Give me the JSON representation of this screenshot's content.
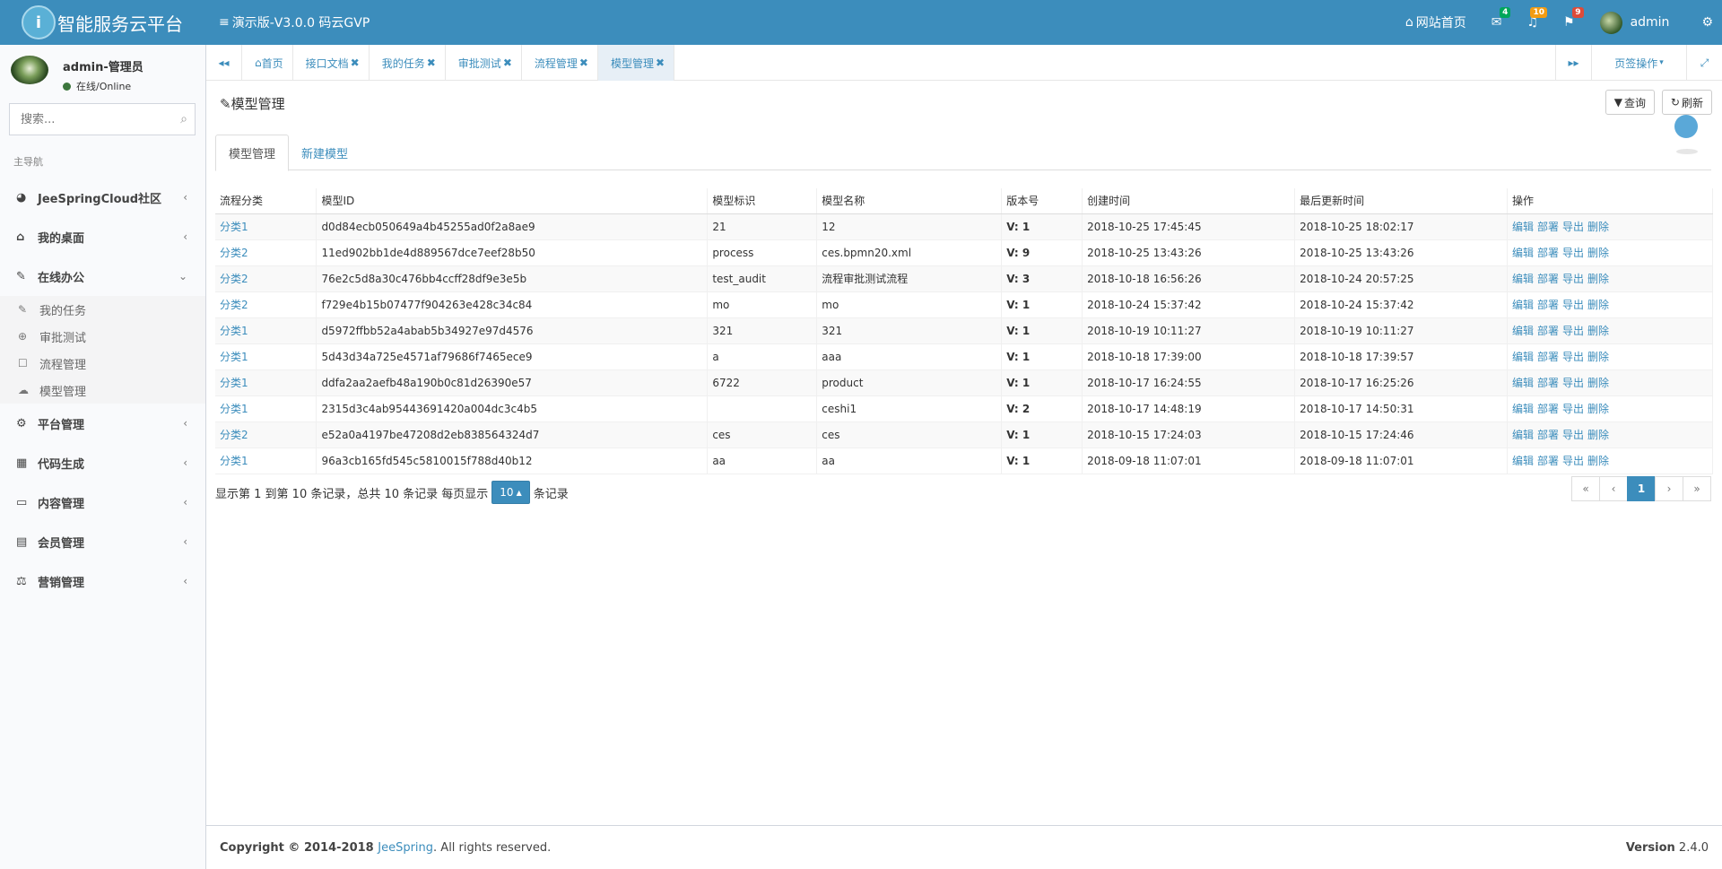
{
  "app": {
    "logo_glyph": "i",
    "title": "智能服务云平台",
    "menu_toggle_label": "演示版-V3.0.0 码云GVP"
  },
  "topnav": {
    "home_label": "网站首页",
    "mail_count": "4",
    "notif_count": "10",
    "flag_count": "9",
    "user_name": "admin"
  },
  "sidebar": {
    "user_name": "admin-管理员",
    "status": "在线/Online",
    "search_placeholder": "搜索...",
    "header": "主导航",
    "items": [
      {
        "icon": "firefox-icon",
        "glyph": "◕",
        "label": "JeeSpringCloud社区",
        "chevron": "‹"
      },
      {
        "icon": "home-icon",
        "glyph": "⌂",
        "label": "我的桌面",
        "chevron": "‹"
      },
      {
        "icon": "edit-icon",
        "glyph": "✎",
        "label": "在线办公",
        "chevron": "⌄"
      }
    ],
    "sub_items": [
      {
        "icon": "edit-icon",
        "glyph": "✎",
        "label": "我的任务"
      },
      {
        "icon": "globe-icon",
        "glyph": "⊕",
        "label": "审批测试"
      },
      {
        "icon": "square-icon",
        "glyph": "☐",
        "label": "流程管理"
      },
      {
        "icon": "cloud-icon",
        "glyph": "☁",
        "label": "模型管理"
      }
    ],
    "items2": [
      {
        "icon": "gear-icon",
        "glyph": "⚙",
        "label": "平台管理",
        "chevron": "‹"
      },
      {
        "icon": "grid-icon",
        "glyph": "▦",
        "label": "代码生成",
        "chevron": "‹"
      },
      {
        "icon": "desktop-icon",
        "glyph": "▭",
        "label": "内容管理",
        "chevron": "‹"
      },
      {
        "icon": "map-icon",
        "glyph": "▤",
        "label": "会员管理",
        "chevron": "‹"
      },
      {
        "icon": "balance-icon",
        "glyph": "⚖",
        "label": "营销管理",
        "chevron": "‹"
      }
    ]
  },
  "tabs": [
    {
      "label": "首页",
      "icon": "home-icon",
      "closable": false
    },
    {
      "label": "接口文档",
      "closable": true
    },
    {
      "label": "我的任务",
      "closable": true
    },
    {
      "label": "审批测试",
      "closable": true
    },
    {
      "label": "流程管理",
      "closable": true
    },
    {
      "label": "模型管理",
      "closable": true,
      "active": true
    }
  ],
  "tabs_toolbar": {
    "page_ops_label": "页签操作"
  },
  "page": {
    "title": "模型管理",
    "query_button": "查询",
    "refresh_button": "刷新",
    "content_tabs": [
      "模型管理",
      "新建模型"
    ]
  },
  "table": {
    "columns": [
      "流程分类",
      "模型ID",
      "模型标识",
      "模型名称",
      "版本号",
      "创建时间",
      "最后更新时间",
      "操作"
    ],
    "rows": [
      [
        "分类1",
        "d0d84ecb050649a4b45255ad0f2a8ae9",
        "21",
        "12",
        "V: 1",
        "2018-10-25 17:45:45",
        "2018-10-25 18:02:17"
      ],
      [
        "分类2",
        "11ed902bb1de4d889567dce7eef28b50",
        "process",
        "ces.bpmn20.xml",
        "V: 9",
        "2018-10-25 13:43:26",
        "2018-10-25 13:43:26"
      ],
      [
        "分类2",
        "76e2c5d8a30c476bb4ccff28df9e3e5b",
        "test_audit",
        "流程审批测试流程",
        "V: 3",
        "2018-10-18 16:56:26",
        "2018-10-24 20:57:25"
      ],
      [
        "分类2",
        "f729e4b15b07477f904263e428c34c84",
        "mo",
        "mo",
        "V: 1",
        "2018-10-24 15:37:42",
        "2018-10-24 15:37:42"
      ],
      [
        "分类1",
        "d5972ffbb52a4abab5b34927e97d4576",
        "321",
        "321",
        "V: 1",
        "2018-10-19 10:11:27",
        "2018-10-19 10:11:27"
      ],
      [
        "分类1",
        "5d43d34a725e4571af79686f7465ece9",
        "a",
        "aaa",
        "V: 1",
        "2018-10-18 17:39:00",
        "2018-10-18 17:39:57"
      ],
      [
        "分类1",
        "ddfa2aa2aefb48a190b0c81d26390e57",
        "6722",
        "product",
        "V: 1",
        "2018-10-17 16:24:55",
        "2018-10-17 16:25:26"
      ],
      [
        "分类1",
        "2315d3c4ab95443691420a004dc3c4b5",
        "",
        "ceshi1",
        "V: 2",
        "2018-10-17 14:48:19",
        "2018-10-17 14:50:31"
      ],
      [
        "分类2",
        "e52a0a4197be47208d2eb838564324d7",
        "ces",
        "ces",
        "V: 1",
        "2018-10-15 17:24:03",
        "2018-10-15 17:24:46"
      ],
      [
        "分类1",
        "96a3cb165fd545c5810015f788d40b12",
        "aa",
        "aa",
        "V: 1",
        "2018-09-18 11:07:01",
        "2018-09-18 11:07:01"
      ]
    ],
    "actions": [
      "编辑",
      "部署",
      "导出",
      "删除"
    ]
  },
  "pagination": {
    "info_prefix": "显示第 1 到第 10 条记录，总共 10 条记录 每页显示",
    "page_size": "10",
    "info_suffix": "条记录",
    "first": "«",
    "prev": "‹",
    "current": "1",
    "next": "›",
    "last": "»"
  },
  "footer": {
    "copyright_prefix": "Copyright © 2014-2018 ",
    "brand": "JeeSpring",
    "copyright_suffix": ". All rights reserved.",
    "version_label": "Version",
    "version": "2.4.0"
  },
  "colors": {
    "primary": "#3c8dbc",
    "badge_green": "#00a65a",
    "badge_orange": "#f39c12",
    "badge_red": "#dd4b39"
  }
}
